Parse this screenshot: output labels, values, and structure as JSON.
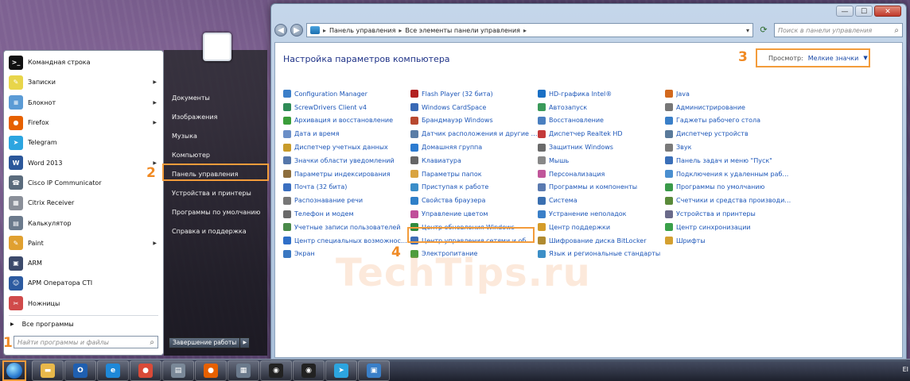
{
  "window": {
    "controls": {
      "minimize": "—",
      "maximize": "☐",
      "close": "✕"
    },
    "address": {
      "crumbs": [
        "Панель управления",
        "Все элементы панели управления"
      ]
    },
    "search_placeholder": "Поиск в панели управления",
    "title": "Настройка параметров компьютера",
    "view": {
      "label": "Просмотр:",
      "value": "Мелкие значки"
    },
    "columns": [
      [
        {
          "label": "Configuration Manager",
          "color": "#3b7fc9"
        },
        {
          "label": "ScrewDrivers Client v4",
          "color": "#2e8b57"
        },
        {
          "label": "Архивация и восстановление",
          "color": "#3a9d3a"
        },
        {
          "label": "Дата и время",
          "color": "#6b8fc7"
        },
        {
          "label": "Диспетчер учетных данных",
          "color": "#c89b2a"
        },
        {
          "label": "Значки области уведомлений",
          "color": "#5577aa"
        },
        {
          "label": "Параметры индексирования",
          "color": "#8c6d3c"
        },
        {
          "label": "Почта (32 бита)",
          "color": "#3a6fc0"
        },
        {
          "label": "Распознавание речи",
          "color": "#777777"
        },
        {
          "label": "Телефон и модем",
          "color": "#6a6a6a"
        },
        {
          "label": "Учетные записи пользователей",
          "color": "#4a8a4a"
        },
        {
          "label": "Центр специальных возможностей",
          "color": "#2f6fc8"
        },
        {
          "label": "Экран",
          "color": "#3a78c2"
        }
      ],
      [
        {
          "label": "Flash Player (32 бита)",
          "color": "#b22222"
        },
        {
          "label": "Windows CardSpace",
          "color": "#3969b5"
        },
        {
          "label": "Брандмауэр Windows",
          "color": "#b8482f"
        },
        {
          "label": "Датчик расположения и другие дат...",
          "color": "#5a7da6"
        },
        {
          "label": "Домашняя группа",
          "color": "#2c7bd0"
        },
        {
          "label": "Клавиатура",
          "color": "#666666"
        },
        {
          "label": "Параметры папок",
          "color": "#d9a441"
        },
        {
          "label": "Приступая к работе",
          "color": "#3a8dc8"
        },
        {
          "label": "Свойства браузера",
          "color": "#2f7fc8"
        },
        {
          "label": "Управление цветом",
          "color": "#c04f9a"
        },
        {
          "label": "Центр обновления Windows",
          "color": "#2f8a3e"
        },
        {
          "label": "Центр управления сетями и общи...",
          "color": "#3d6db5"
        },
        {
          "label": "Электропитание",
          "color": "#4f9d3e"
        }
      ],
      [
        {
          "label": "HD-графика Intel®",
          "color": "#1a6fc4"
        },
        {
          "label": "Автозапуск",
          "color": "#3a9a5a"
        },
        {
          "label": "Восстановление",
          "color": "#4a7fc0"
        },
        {
          "label": "Диспетчер Realtek HD",
          "color": "#c43a3a"
        },
        {
          "label": "Защитник Windows",
          "color": "#6a6a6a"
        },
        {
          "label": "Мышь",
          "color": "#888888"
        },
        {
          "label": "Персонализация",
          "color": "#c0569a"
        },
        {
          "label": "Программы и компоненты",
          "color": "#5a7ab0"
        },
        {
          "label": "Система",
          "color": "#3a6fb0"
        },
        {
          "label": "Устранение неполадок",
          "color": "#3a7fc8"
        },
        {
          "label": "Центр поддержки",
          "color": "#d49c2a"
        },
        {
          "label": "Шифрование диска BitLocker",
          "color": "#b08a30"
        },
        {
          "label": "Язык и региональные стандарты",
          "color": "#3c8fc7"
        }
      ],
      [
        {
          "label": "Java",
          "color": "#d2691e"
        },
        {
          "label": "Администрирование",
          "color": "#777777"
        },
        {
          "label": "Гаджеты рабочего стола",
          "color": "#3a7fc8"
        },
        {
          "label": "Диспетчер устройств",
          "color": "#5a7a9a"
        },
        {
          "label": "Звук",
          "color": "#7a7a7a"
        },
        {
          "label": "Панель задач и меню \"Пуск\"",
          "color": "#3a6fb8"
        },
        {
          "label": "Подключения к удаленным рабоч...",
          "color": "#4a8fd0"
        },
        {
          "label": "Программы по умолчанию",
          "color": "#3a9a4a"
        },
        {
          "label": "Счетчики и средства производител...",
          "color": "#5a8a3a"
        },
        {
          "label": "Устройства и принтеры",
          "color": "#6a6a8a"
        },
        {
          "label": "Центр синхронизации",
          "color": "#3aa04a"
        },
        {
          "label": "Шрифты",
          "color": "#d4a030"
        }
      ]
    ],
    "watermark": "TechTips.ru"
  },
  "steps": {
    "one": "1",
    "two": "2",
    "three": "3",
    "four": "4"
  },
  "start_menu": {
    "programs": [
      {
        "label": "Командная строка",
        "icon": "cmd-icon",
        "color": "#111111",
        "glyph": ">_",
        "arrow": ""
      },
      {
        "label": "Записки",
        "icon": "sticky-notes-icon",
        "color": "#e8d54a",
        "glyph": "✎",
        "arrow": "▶"
      },
      {
        "label": "Блокнот",
        "icon": "notepad-icon",
        "color": "#5b9bd5",
        "glyph": "≡",
        "arrow": "▶"
      },
      {
        "label": "Firefox",
        "icon": "firefox-icon",
        "color": "#e66000",
        "glyph": "●",
        "arrow": "▶"
      },
      {
        "label": "Telegram",
        "icon": "telegram-icon",
        "color": "#2ca5e0",
        "glyph": "➤",
        "arrow": ""
      },
      {
        "label": "Word 2013",
        "icon": "word-icon",
        "color": "#2b579a",
        "glyph": "W",
        "arrow": "▶"
      },
      {
        "label": "Cisco IP Communicator",
        "icon": "cisco-icon",
        "color": "#5a6b7c",
        "glyph": "☎",
        "arrow": ""
      },
      {
        "label": "Citrix Receiver",
        "icon": "citrix-icon",
        "color": "#8a8f99",
        "glyph": "▦",
        "arrow": ""
      },
      {
        "label": "Калькулятор",
        "icon": "calculator-icon",
        "color": "#6b7a8c",
        "glyph": "▤",
        "arrow": ""
      },
      {
        "label": "Paint",
        "icon": "paint-icon",
        "color": "#e0a030",
        "glyph": "✎",
        "arrow": "▶"
      },
      {
        "label": "ARM",
        "icon": "arm-icon",
        "color": "#3c4a6b",
        "glyph": "▣",
        "arrow": ""
      },
      {
        "label": "АРМ Оператора CTI",
        "icon": "operator-icon",
        "color": "#2c5aa0",
        "glyph": "☺",
        "arrow": ""
      },
      {
        "label": "Ножницы",
        "icon": "scissors-icon",
        "color": "#d04a4a",
        "glyph": "✂",
        "arrow": ""
      }
    ],
    "all_programs": "Все программы",
    "search_placeholder": "Найти программы и файлы",
    "right_items": [
      "Документы",
      "Изображения",
      "Музыка",
      "Компьютер",
      "Панель управления",
      "Устройства и принтеры",
      "Программы по умолчанию",
      "Справка и поддержка"
    ],
    "shutdown": "Завершение работы",
    "shutdown_arrow": "▶"
  },
  "taskbar": {
    "items": [
      {
        "name": "explorer-icon",
        "color": "#e8b84a",
        "glyph": "▬"
      },
      {
        "name": "outlook-icon",
        "color": "#1f5fb0",
        "glyph": "O"
      },
      {
        "name": "ie-icon",
        "color": "#1e88d8",
        "glyph": "e"
      },
      {
        "name": "chrome-icon",
        "color": "#d94a38",
        "glyph": "●"
      },
      {
        "name": "scanner-icon",
        "color": "#7a8898",
        "glyph": "▤"
      },
      {
        "name": "firefox-icon",
        "color": "#e66000",
        "glyph": "●"
      },
      {
        "name": "calculator-icon",
        "color": "#6b7a8c",
        "glyph": "▦"
      },
      {
        "name": "cti-icon",
        "color": "#222222",
        "glyph": "◉"
      },
      {
        "name": "cti2-icon",
        "color": "#222222",
        "glyph": "◉"
      },
      {
        "name": "telegram-icon",
        "color": "#2ca5e0",
        "glyph": "➤"
      },
      {
        "name": "remote-desktop-icon",
        "color": "#3a7fc8",
        "glyph": "▣"
      }
    ],
    "tray": "EI"
  }
}
